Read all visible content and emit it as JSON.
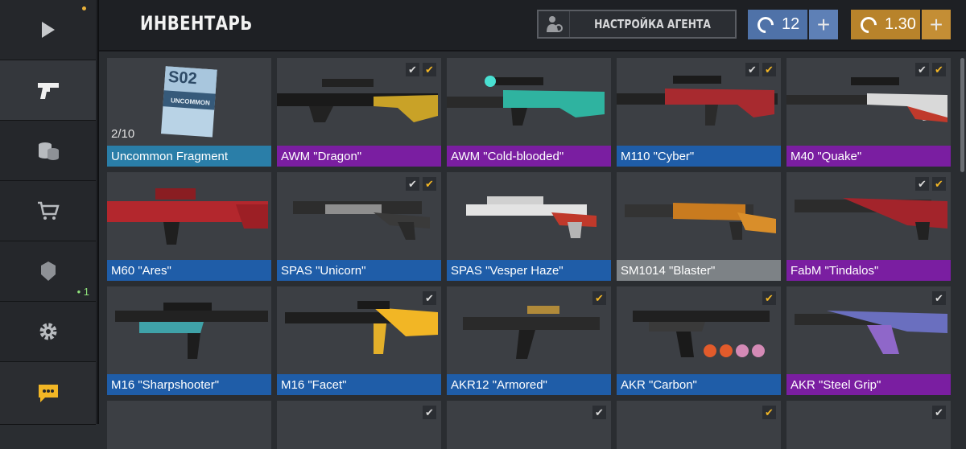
{
  "header": {
    "title": "ИНВЕНТАРЬ",
    "agent_button": "НАСТРОЙКА АГЕНТА",
    "credits": {
      "value": "12",
      "plus": "+"
    },
    "gold": {
      "value": "1.30",
      "plus": "+"
    }
  },
  "sidebar": {
    "items": [
      {
        "icon": "play-icon"
      },
      {
        "icon": "pistol-icon",
        "active": true
      },
      {
        "icon": "coins-icon"
      },
      {
        "icon": "cart-icon"
      },
      {
        "icon": "rank-icon",
        "badge": "• 1"
      },
      {
        "icon": "gear-icon"
      },
      {
        "icon": "chat-icon"
      }
    ]
  },
  "fragment": {
    "title": "S02",
    "subtitle": "UNCOMMON",
    "count": "2/10"
  },
  "items": [
    {
      "name": "Uncommon Fragment",
      "rarity": "teal"
    },
    {
      "name": "AWM \"Dragon\"",
      "rarity": "purple"
    },
    {
      "name": "AWM \"Cold-blooded\"",
      "rarity": "purple"
    },
    {
      "name": "M110 \"Cyber\"",
      "rarity": "blue"
    },
    {
      "name": "M40 \"Quake\"",
      "rarity": "purple"
    },
    {
      "name": "M60 \"Ares\"",
      "rarity": "blue"
    },
    {
      "name": "SPAS \"Unicorn\"",
      "rarity": "blue"
    },
    {
      "name": "SPAS \"Vesper Haze\"",
      "rarity": "blue"
    },
    {
      "name": "SM1014 \"Blaster\"",
      "rarity": "gray"
    },
    {
      "name": "FabM \"Tindalos\"",
      "rarity": "purple"
    },
    {
      "name": "M16 \"Sharpshooter\"",
      "rarity": "blue"
    },
    {
      "name": "M16 \"Facet\"",
      "rarity": "blue"
    },
    {
      "name": "AKR12 \"Armored\"",
      "rarity": "blue"
    },
    {
      "name": "AKR \"Carbon\"",
      "rarity": "blue"
    },
    {
      "name": "AKR \"Steel Grip\"",
      "rarity": "purple"
    }
  ],
  "colors": {
    "blue": "#1f5da8",
    "purple": "#7a1ea1",
    "gray": "#7d8286",
    "teal": "#2a7ea8",
    "gold": "#b8832b",
    "credits": "#4f72a8"
  }
}
